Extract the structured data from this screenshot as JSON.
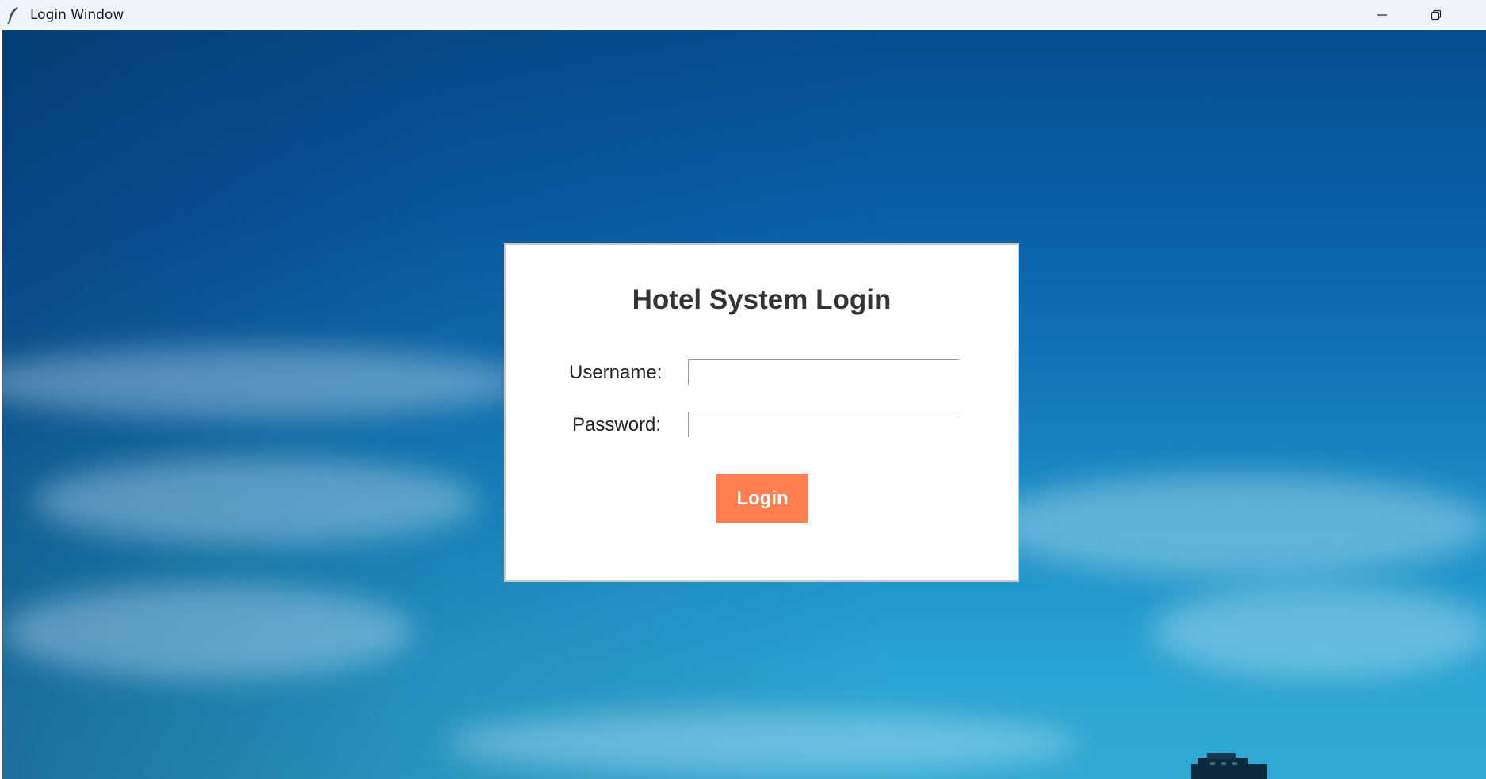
{
  "window": {
    "title": "Login Window",
    "app_icon": "feather-icon",
    "controls": [
      "minimize-icon",
      "restore-icon"
    ]
  },
  "login": {
    "heading": "Hotel System Login",
    "username_label": "Username:",
    "password_label": "Password:",
    "username_value": "",
    "password_value": "",
    "button_label": "Login"
  },
  "colors": {
    "button": "#ff7f50",
    "sky_top": "#064f8f",
    "sky_bottom": "#31a9d4",
    "card": "#ffffff"
  }
}
